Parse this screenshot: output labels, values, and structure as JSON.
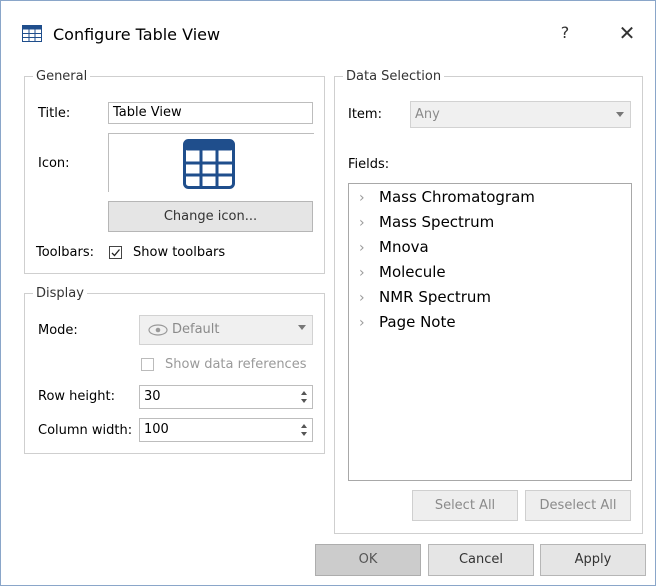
{
  "window": {
    "title": "Configure Table View",
    "help_label": "?",
    "close_label": "✕"
  },
  "general": {
    "legend": "General",
    "title_label": "Title:",
    "title_value": "Table View",
    "icon_label": "Icon:",
    "change_icon_label": "Change icon...",
    "toolbars_label": "Toolbars:",
    "show_toolbars_label": "Show toolbars",
    "show_toolbars_checked": true
  },
  "display": {
    "legend": "Display",
    "mode_label": "Mode:",
    "mode_value": "Default",
    "show_data_refs_label": "Show data references",
    "row_height_label": "Row height:",
    "row_height_value": "30",
    "column_width_label": "Column width:",
    "column_width_value": "100"
  },
  "data_selection": {
    "legend": "Data Selection",
    "item_label": "Item:",
    "item_value": "Any",
    "fields_label": "Fields:",
    "fields": [
      {
        "label": "Mass Chromatogram"
      },
      {
        "label": "Mass Spectrum"
      },
      {
        "label": "Mnova"
      },
      {
        "label": "Molecule"
      },
      {
        "label": "NMR Spectrum"
      },
      {
        "label": "Page Note"
      }
    ],
    "select_all_label": "Select All",
    "deselect_all_label": "Deselect All"
  },
  "footer": {
    "ok_label": "OK",
    "cancel_label": "Cancel",
    "apply_label": "Apply"
  },
  "colors": {
    "icon_blue": "#1f4e8c",
    "border": "#cfcfcf"
  }
}
